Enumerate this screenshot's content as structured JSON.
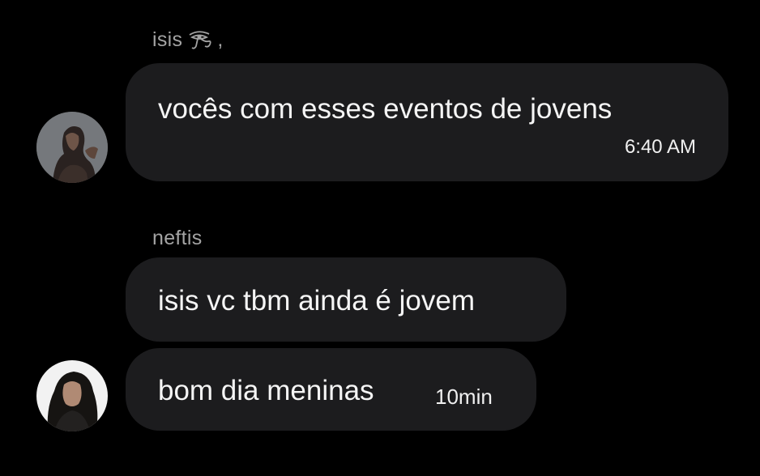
{
  "messages": [
    {
      "sender": "isis",
      "sender_suffix": ",",
      "sender_icon": "eye-of-horus-icon",
      "text": "vocês com esses eventos de jovens",
      "time": "6:40 AM"
    },
    {
      "sender": "neftis",
      "text": "isis vc tbm ainda é jovem"
    },
    {
      "text": "bom dia meninas",
      "time": "10min"
    }
  ],
  "colors": {
    "background": "#000000",
    "bubble": "#1c1c1e",
    "name": "#a3a3a3",
    "text": "#f5f5f5"
  }
}
